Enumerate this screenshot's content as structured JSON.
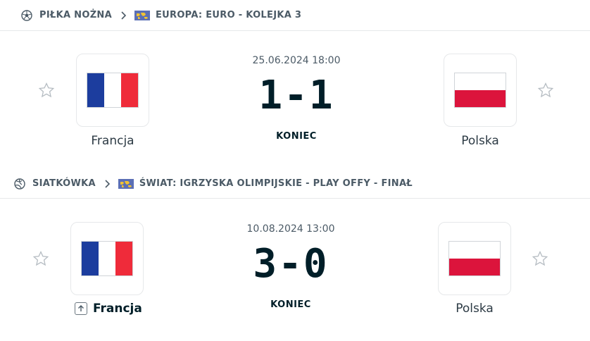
{
  "matches": [
    {
      "sport": "PIŁKA NOŻNA",
      "sport_icon": "soccer-ball-icon",
      "league": "EUROPA: EURO - KOLEJKA 3",
      "datetime": "25.06.2024 18:00",
      "score": "1-1",
      "status": "KONIEC",
      "home": {
        "name": "Francja",
        "flag": "france-flag"
      },
      "away": {
        "name": "Polska",
        "flag": "poland-flag"
      }
    },
    {
      "sport": "SIATKÓWKA",
      "sport_icon": "volleyball-icon",
      "league": "ŚWIAT: IGRZYSKA OLIMPIJSKIE - PLAY OFFY - FINAŁ",
      "datetime": "10.08.2024 13:00",
      "score": "3-0",
      "status": "KONIEC",
      "home": {
        "name": "Francja",
        "flag": "france-flag",
        "winner": true
      },
      "away": {
        "name": "Polska",
        "flag": "poland-flag"
      }
    }
  ],
  "colors": {
    "france_blue": "#1c3d9e",
    "france_white": "#ffffff",
    "france_red": "#ef2b3a",
    "poland_white": "#ffffff",
    "poland_red": "#dc143c",
    "world_flag_bg": "#5b6fb5",
    "world_flag_land": "#f1c232"
  }
}
